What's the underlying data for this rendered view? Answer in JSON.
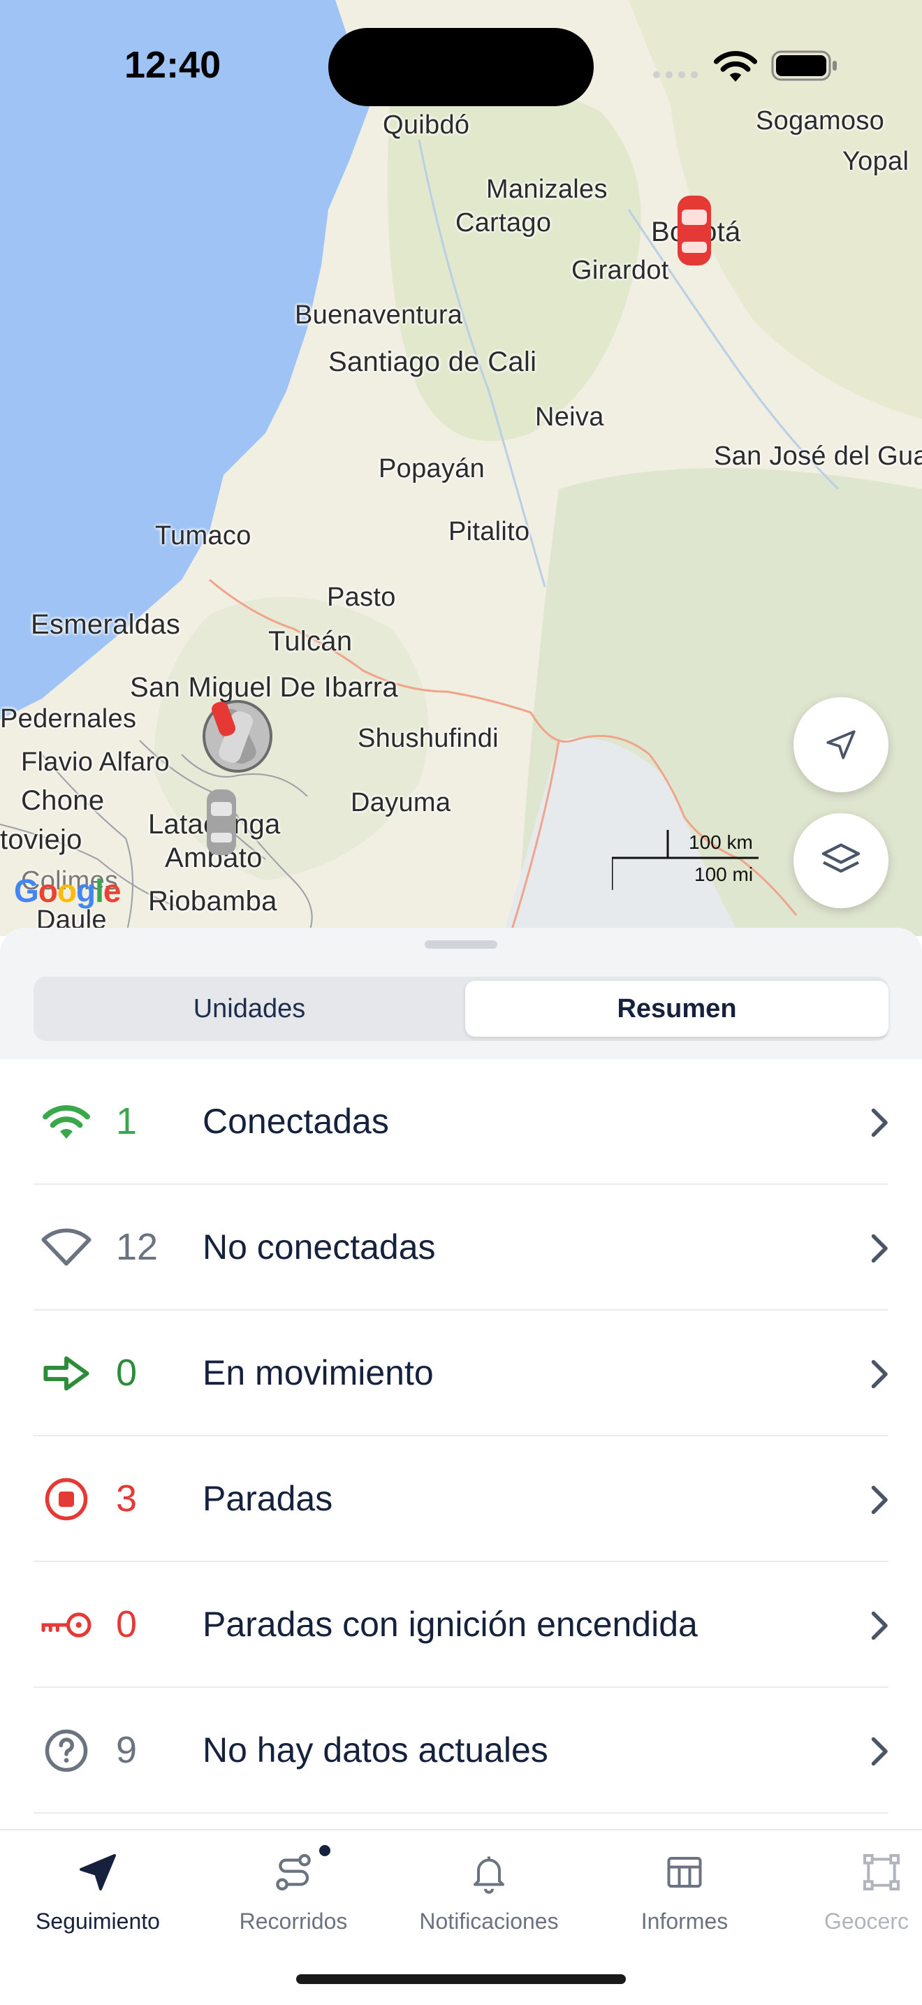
{
  "status_bar": {
    "time": "12:40"
  },
  "map": {
    "cities": [
      "Quibdó",
      "Sogamoso",
      "Yopal",
      "Manizales",
      "Cartago",
      "Bogotá",
      "Girardot",
      "Buenaventura",
      "Santiago de Cali",
      "Neiva",
      "San José del Gua",
      "Popayán",
      "Tumaco",
      "Pitalito",
      "Pasto",
      "Esmeraldas",
      "Tulcán",
      "San Miguel De Ibarra",
      "Pedernales",
      "Shushufindi",
      "Flavio Alfaro",
      "Chone",
      "Dayuma",
      "toviejo",
      "Latacunga",
      "Ambato",
      "Riobamba",
      "Colimes",
      "Daule"
    ],
    "google_label": "Google",
    "scale": {
      "km": "100 km",
      "mi": "100 mi"
    },
    "locate_button": "locate-button",
    "layers_button": "layers-button"
  },
  "segmented": {
    "left": "Unidades",
    "right": "Resumen",
    "selected": "Resumen"
  },
  "summary": [
    {
      "count": "1",
      "label": "Conectadas",
      "color": "#3aa84a",
      "icon": "wifi-icon"
    },
    {
      "count": "12",
      "label": "No conectadas",
      "color": "#6b7280",
      "icon": "wifi-off-icon"
    },
    {
      "count": "0",
      "label": "En movimiento",
      "color": "#2e8b3a",
      "icon": "arrow-right-icon"
    },
    {
      "count": "3",
      "label": "Paradas",
      "color": "#e53935",
      "icon": "stop-icon"
    },
    {
      "count": "0",
      "label": "Paradas con ignición encendida",
      "color": "#e53935",
      "icon": "key-icon"
    },
    {
      "count": "9",
      "label": "No hay datos actuales",
      "color": "#6b7280",
      "icon": "question-icon"
    }
  ],
  "tabs": [
    {
      "label": "Seguimiento",
      "active": true,
      "icon": "navigation-arrow-icon"
    },
    {
      "label": "Recorridos",
      "active": false,
      "icon": "route-icon",
      "badge": true
    },
    {
      "label": "Notificaciones",
      "active": false,
      "icon": "bell-icon"
    },
    {
      "label": "Informes",
      "active": false,
      "icon": "table-icon"
    },
    {
      "label": "Geocerc",
      "active": false,
      "icon": "geofence-icon"
    }
  ],
  "colors": {
    "water": "#9ec3f4",
    "land": "#f1eee2",
    "accent": "#16213e"
  }
}
